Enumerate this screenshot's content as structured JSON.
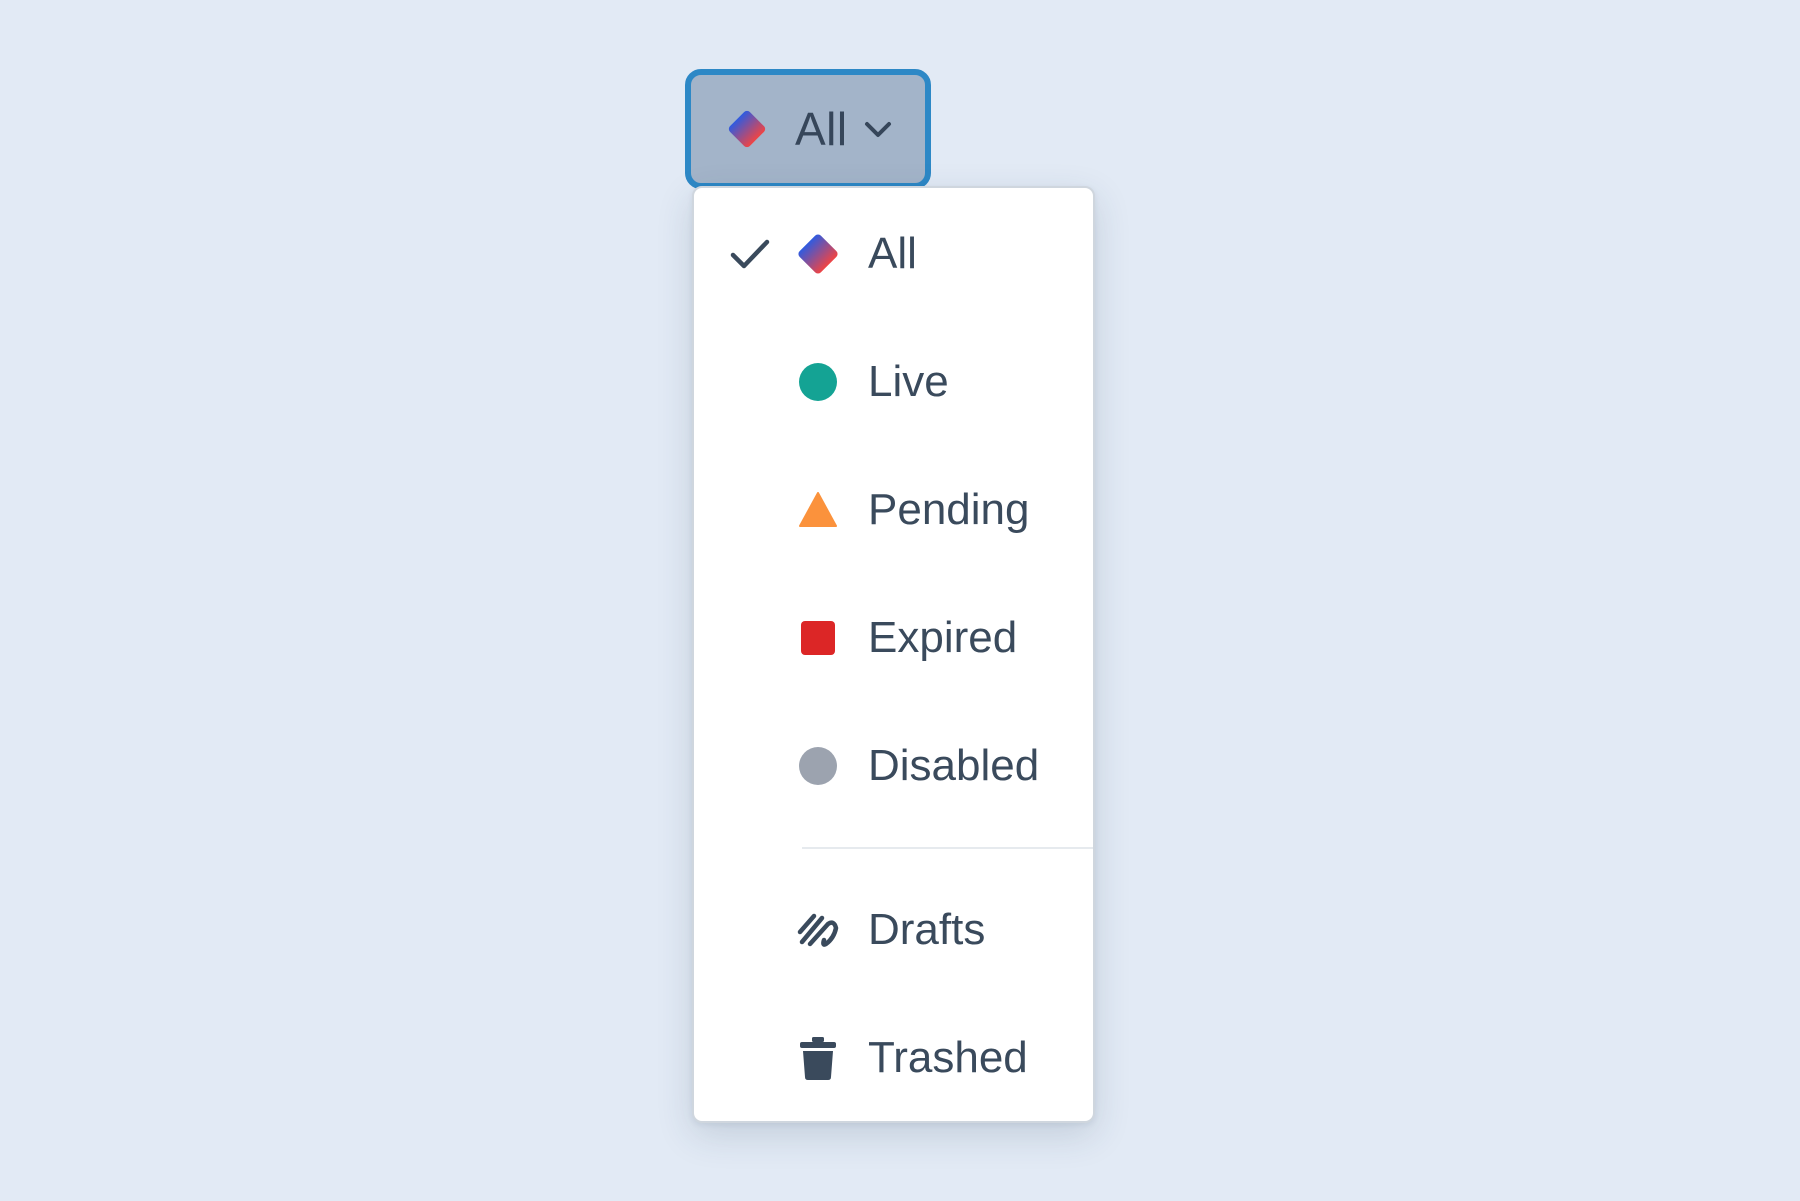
{
  "trigger": {
    "label": "All",
    "icon": "gradient-diamond-icon",
    "chevron_icon": "chevron-down-icon"
  },
  "menu": {
    "selected": "All",
    "status_items": [
      {
        "label": "All",
        "icon": "gradient-diamond-icon",
        "checked": true
      },
      {
        "label": "Live",
        "icon": "circle-icon",
        "color": "#14a394"
      },
      {
        "label": "Pending",
        "icon": "triangle-icon",
        "color": "#fb923c"
      },
      {
        "label": "Expired",
        "icon": "square-icon",
        "color": "#dc2626"
      },
      {
        "label": "Disabled",
        "icon": "circle-icon",
        "color": "#9ca3af"
      }
    ],
    "other_items": [
      {
        "label": "Drafts",
        "icon": "scribble-icon"
      },
      {
        "label": "Trashed",
        "icon": "trash-icon"
      }
    ]
  },
  "colors": {
    "background": "#e2eaf5",
    "focus_ring": "#2d88c6",
    "trigger_bg": "#a3b4c9",
    "diamond_gradient_start": "#2f5be0",
    "diamond_gradient_end": "#ef4444",
    "text": "#3a4a5c"
  }
}
